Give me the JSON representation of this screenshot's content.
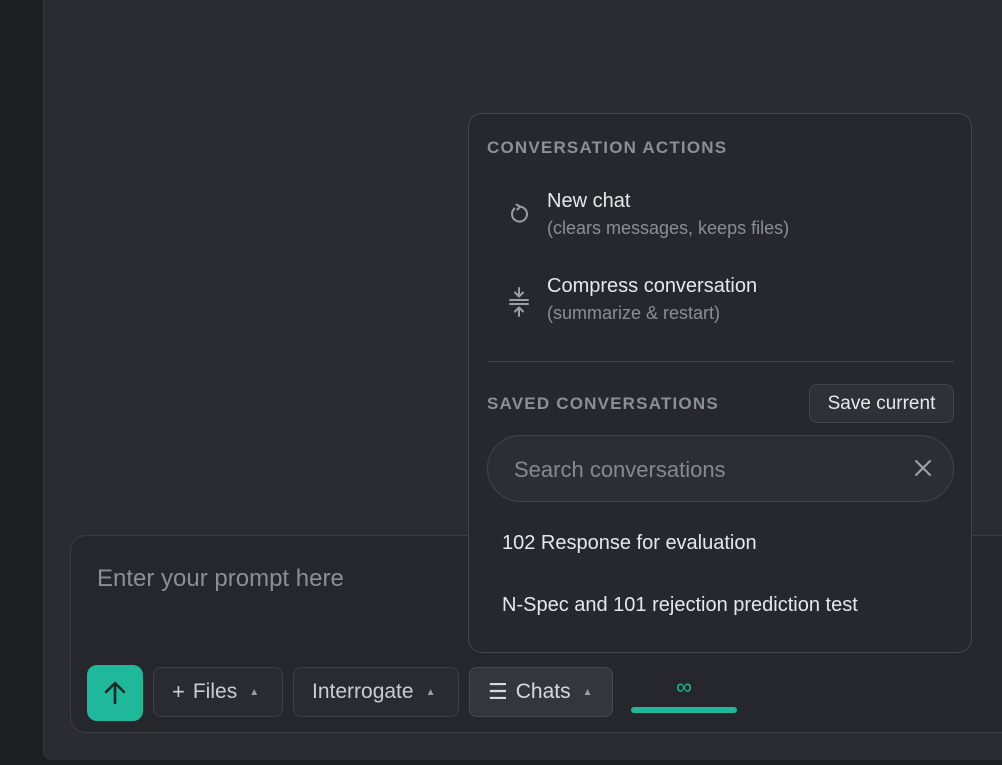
{
  "composer": {
    "placeholder": "Enter your prompt here",
    "send_icon": "arrow-up-icon",
    "chips": {
      "files": {
        "label": "Files",
        "icon": "plus-icon"
      },
      "interrogate": {
        "label": "Interrogate"
      },
      "chats": {
        "label": "Chats",
        "icon": "menu-lines-icon"
      }
    },
    "context_meter": {
      "symbol": "∞",
      "fill": 1.0
    }
  },
  "menu": {
    "actions_heading": "CONVERSATION ACTIONS",
    "actions": [
      {
        "title": "New chat",
        "subtitle": "(clears messages, keeps files)",
        "icon": "refresh-icon"
      },
      {
        "title": "Compress conversation",
        "subtitle": "(summarize & restart)",
        "icon": "compress-icon"
      }
    ],
    "saved_heading": "SAVED CONVERSATIONS",
    "save_current_label": "Save current",
    "search_placeholder": "Search conversations",
    "saved": [
      "102 Response for evaluation",
      "N-Spec and 101 rejection prediction test"
    ]
  },
  "colors": {
    "accent": "#1fb89a",
    "panel": "#2a2c31",
    "menu": "#26282d"
  }
}
